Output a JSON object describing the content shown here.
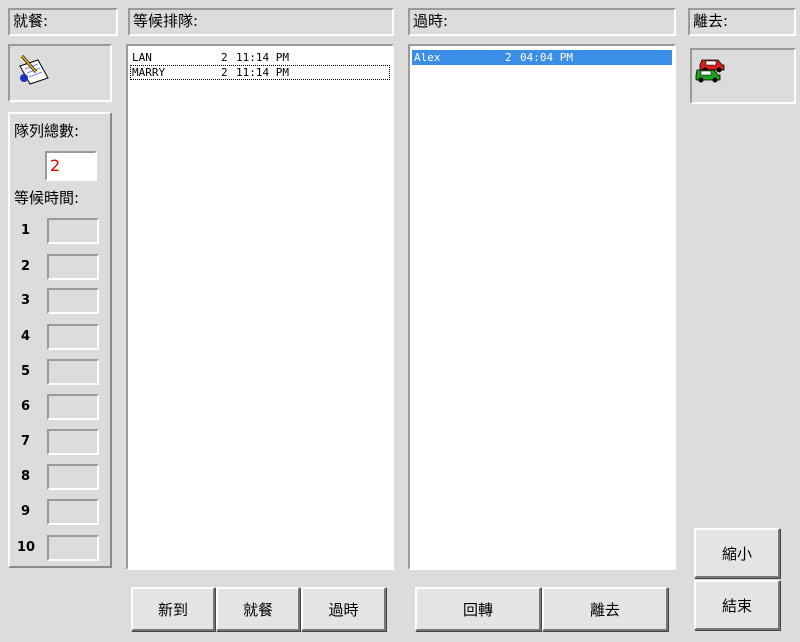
{
  "dining": {
    "header": "就餐:",
    "icon": "writing-pad-icon"
  },
  "queue": {
    "header": "等候排隊:",
    "rows": [
      {
        "name": "LAN",
        "count": "2",
        "time": "11:14 PM"
      },
      {
        "name": "MARRY",
        "count": "2",
        "time": "11:14 PM"
      }
    ]
  },
  "overdue": {
    "header": "過時:",
    "rows": [
      {
        "name": "Alex",
        "count": "2",
        "time": "04:04 PM"
      }
    ]
  },
  "leave": {
    "header": "離去:",
    "icon": "cars-icon"
  },
  "stats": {
    "total_label": "隊列總數:",
    "total_value": "2",
    "wait_label": "等候時間:",
    "slots": [
      "1",
      "2",
      "3",
      "4",
      "5",
      "6",
      "7",
      "8",
      "9",
      "10"
    ]
  },
  "buttons": {
    "new_arrival": "新到",
    "dine": "就餐",
    "expire": "過時",
    "return": "回轉",
    "leave": "離去",
    "minimize": "縮小",
    "end": "結束"
  },
  "colors": {
    "selection": "#3a8ee8",
    "total_value": "#e00000",
    "background": "#dcdcdc"
  }
}
